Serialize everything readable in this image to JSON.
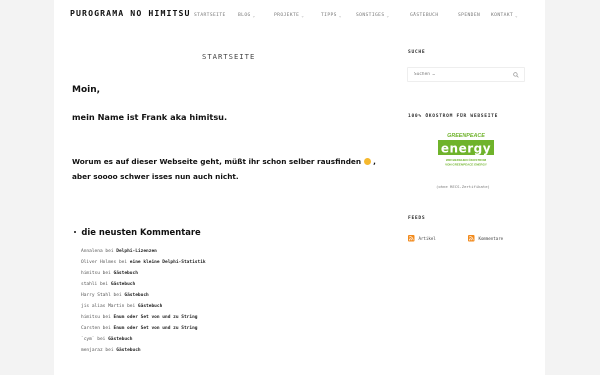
{
  "header": {
    "site_title": "PUROGRAMA NO HIMITSU",
    "nav": [
      {
        "label": "STARTSEITE",
        "dropdown": false
      },
      {
        "label": "BLOG",
        "dropdown": true
      },
      {
        "label": "PROJEKTE",
        "dropdown": true
      },
      {
        "label": "TIPPS",
        "dropdown": true
      },
      {
        "label": "SONSTIGES",
        "dropdown": true
      },
      {
        "label": "GÄSTEBUCH",
        "dropdown": false
      },
      {
        "label": "SPENDEN",
        "dropdown": false
      },
      {
        "label": "KONTAKT",
        "dropdown": true
      }
    ]
  },
  "main": {
    "heading": "STARTSEITE",
    "greeting": "Moin,",
    "intro": "mein Name ist Frank aka himitsu.",
    "paragraph_before": "Worum es auf dieser Webseite geht, müßt ihr schon selber rausfinden",
    "paragraph_after": ", aber soooo schwer isses nun auch nicht.",
    "comments_heading": "die neusten Kommentare",
    "comments": [
      {
        "author": "Annalena",
        "sep": " bei ",
        "post": "Delphi-Lizenzen"
      },
      {
        "author": "Oliver Holmes",
        "sep": " bei ",
        "post": "eine kleine Delphi-Statistik"
      },
      {
        "author": "himitsu",
        "sep": " bei ",
        "post": "Gästebuch"
      },
      {
        "author": "stahli",
        "sep": " bei ",
        "post": "Gästebuch"
      },
      {
        "author": "Harry Stahl",
        "sep": " bei ",
        "post": "Gästebuch"
      },
      {
        "author": "jis alias Martin",
        "sep": " bei ",
        "post": "Gästebuch"
      },
      {
        "author": "himitsu",
        "sep": " bei ",
        "post": "Enum oder Set von und zu String"
      },
      {
        "author": "Carsten",
        "sep": " bei ",
        "post": "Enum oder Set von und zu String"
      },
      {
        "author": "`cym`",
        "sep": " bei ",
        "post": "Gästebuch"
      },
      {
        "author": "menjaraz",
        "sep": " bei ",
        "post": "Gästebuch"
      }
    ]
  },
  "sidebar": {
    "search_heading": "SUCHE",
    "search_placeholder": "Suchen …",
    "eco_heading": "100% ÖKOSTROM FÜR WEBSEITE",
    "logo_lines": [
      "GREENPEACE",
      "energy",
      "WIR BEZIEHEN ÖKOSTROM",
      "VON GREENPEACE ENERGY"
    ],
    "logo_note": "(ohne RECS-Zertifikate)",
    "feeds_heading": "FEEDS",
    "feeds": [
      "Artikel",
      "Kommentare"
    ]
  },
  "colors": {
    "background": "#f3f3f3",
    "page": "#ffffff",
    "greenpeace_green": "#6fb32b",
    "rss_orange": "#f28a1c",
    "smiley_yellow": "#f5b82e"
  }
}
